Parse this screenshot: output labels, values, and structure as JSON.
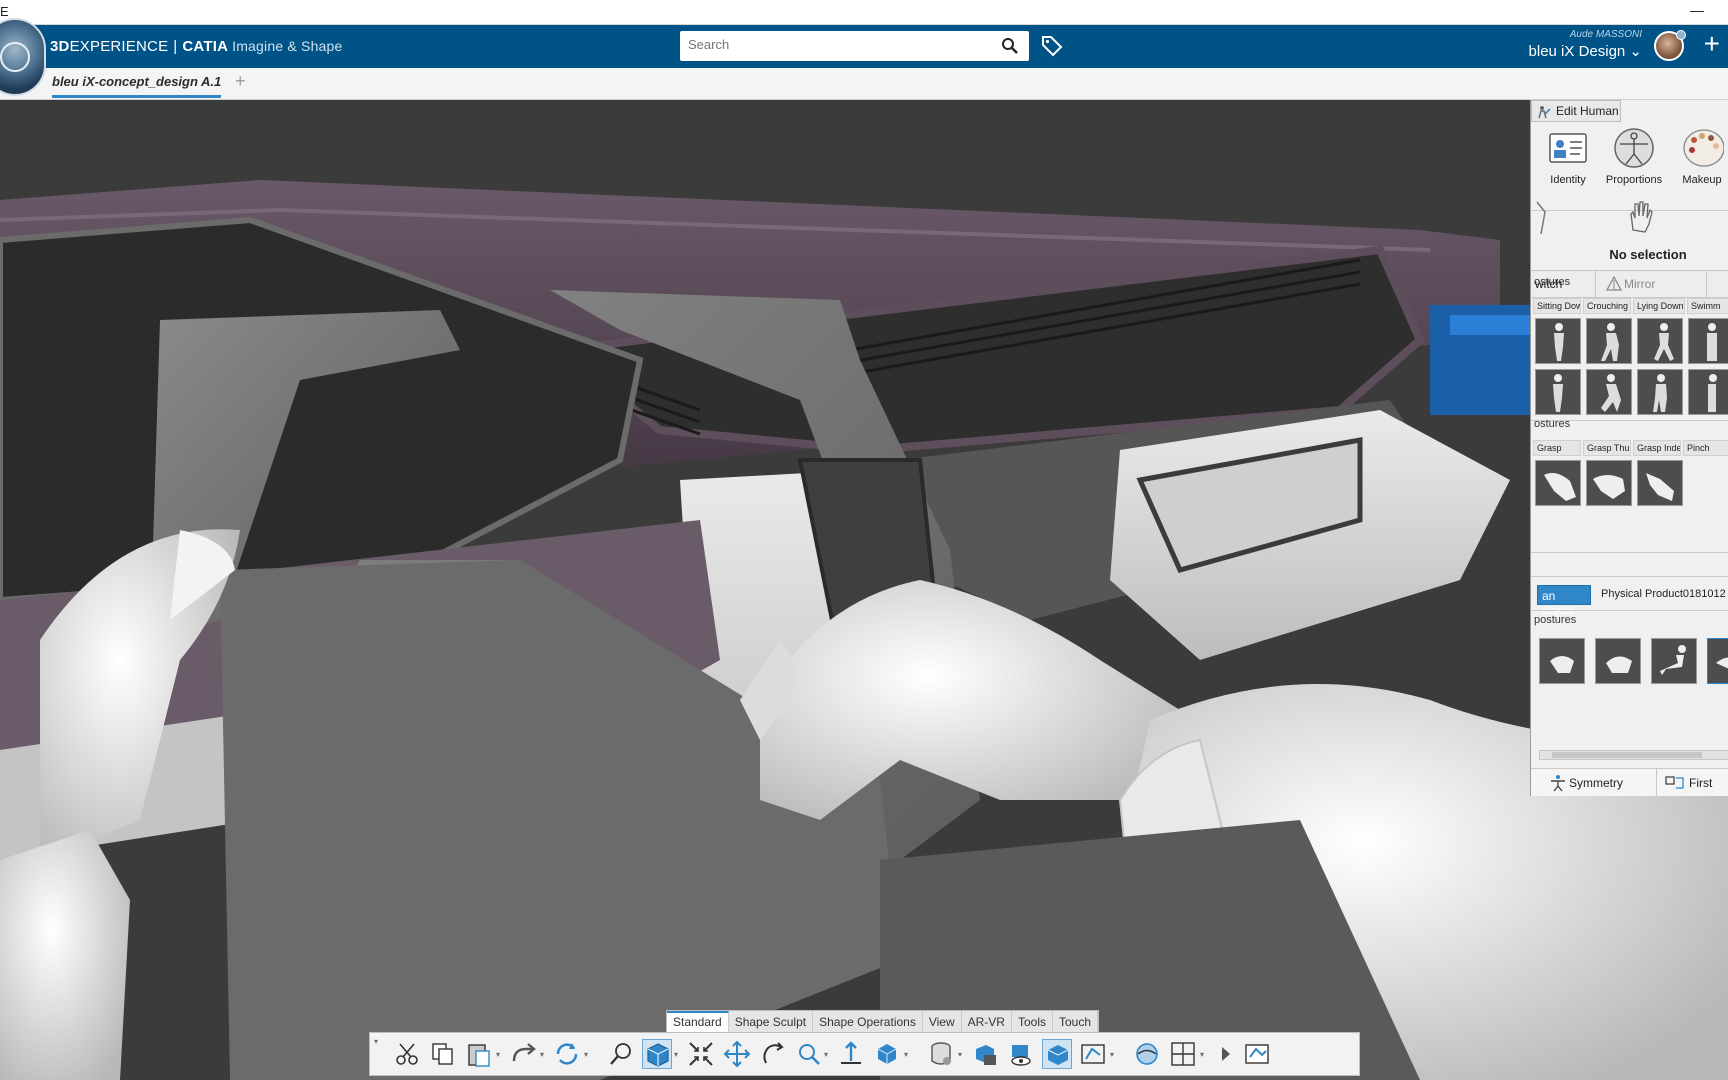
{
  "window": {
    "title_fragment": "E",
    "minimize_glyph": "—"
  },
  "header": {
    "brand_3d": "3D",
    "brand_experience": "EXPERIENCE",
    "brand_sep": "|",
    "brand_catia": "CATIA",
    "brand_app": "Imagine & Shape",
    "search_placeholder": "Search",
    "user_name": "Aude MASSONI",
    "tenant": "bleu iX Design ⌄",
    "add_glyph": "+"
  },
  "tabs": [
    {
      "label": "bleu iX-concept_design A.1",
      "active": true
    }
  ],
  "tab_add_glyph": "+",
  "panel": {
    "title": "Edit Human",
    "tools": [
      {
        "label": "Identity",
        "icon": "id-card-icon"
      },
      {
        "label": "Proportions",
        "icon": "vitruvian-icon"
      },
      {
        "label": "Makeup",
        "icon": "palette-icon"
      }
    ],
    "selection_text": "No selection",
    "switch_label": "witch",
    "mirror_label": "Mirror",
    "body_postures_label": "ostures",
    "body_postures_tabs": [
      "Sitting Dow",
      "Crouching",
      "Lying Down",
      "Swimm"
    ],
    "hand_postures_label": "ostures",
    "hand_postures_tabs": [
      "Grasp",
      "Grasp Thu",
      "Grasp Inde",
      "Pinch"
    ],
    "object_button": "an object",
    "object_name": "Physical Product0181012",
    "object_postures_label": "postures",
    "symmetry_label": "Symmetry",
    "first_label": "First"
  },
  "command_tabs": [
    {
      "label": "Standard",
      "active": true
    },
    {
      "label": "Shape Sculpt",
      "active": false
    },
    {
      "label": "Shape Operations",
      "active": false
    },
    {
      "label": "View",
      "active": false
    },
    {
      "label": "AR-VR",
      "active": false
    },
    {
      "label": "Tools",
      "active": false
    },
    {
      "label": "Touch",
      "active": false
    }
  ],
  "command_icons": [
    "cut-icon",
    "copy-icon",
    "paste-icon",
    "redo-icon",
    "update-icon",
    "zoom-area-icon",
    "view-mode-icon",
    "fit-all-icon",
    "pan-icon",
    "rotate-icon",
    "zoom-icon",
    "normal-view-icon",
    "iso-view-icon",
    "render-style-icon",
    "hide-show-icon",
    "look-at-icon",
    "depth-icon",
    "section-icon",
    "ambience-icon",
    "multi-view-icon",
    "more-icon",
    "workbench-icon"
  ],
  "colors": {
    "header_blue": "#005386",
    "accent": "#2f87c9",
    "viewport_bg": "#3b3b3b",
    "dashboard_purple": "#5e4e5c",
    "skin_white": "#e4e4e4"
  }
}
